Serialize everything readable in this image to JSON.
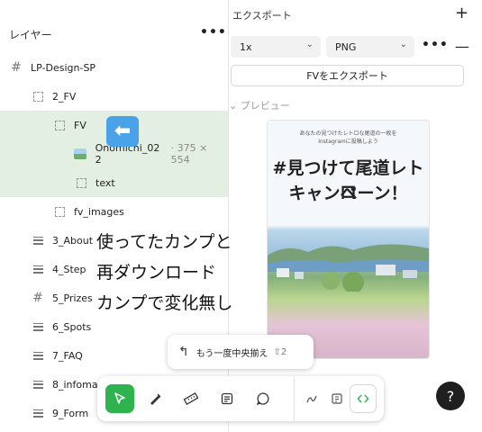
{
  "layers_panel": {
    "title": "レイヤー",
    "more": "•••",
    "rows": [
      {
        "label": "LP-Design-SP",
        "kind": "hash"
      },
      {
        "label": "2_FV",
        "kind": "frame"
      },
      {
        "label": "FV",
        "kind": "frame",
        "selected": true
      },
      {
        "label": "Onomichi_02 2",
        "dims": "· 375 × 554",
        "kind": "image",
        "selected": true
      },
      {
        "label": "text",
        "kind": "frame",
        "selected": true
      },
      {
        "label": "fv_images",
        "kind": "frame"
      },
      {
        "label": "3_About",
        "kind": "bars"
      },
      {
        "label": "4_Step",
        "kind": "bars"
      },
      {
        "label": "5_Prizes",
        "kind": "hash"
      },
      {
        "label": "6_Spots",
        "kind": "bars"
      },
      {
        "label": "7_FAQ",
        "kind": "bars"
      },
      {
        "label": "8_infomati",
        "kind": "bars"
      },
      {
        "label": "9_Form",
        "kind": "bars"
      }
    ]
  },
  "overlay": {
    "arrow": "⬅",
    "lines": [
      "使ってたカンプと",
      "再ダウンロード",
      "カンプで変化無し"
    ]
  },
  "export_panel": {
    "title": "エクスポート",
    "add": "+",
    "scale": "1x",
    "format": "PNG",
    "more": "•••",
    "remove": "—",
    "export_button": "FVをエクスポート",
    "preview_label": "⌄ プレビュー",
    "preview": {
      "sub_line1": "あなたの見つけたレトロな尾道の一枚を",
      "sub_line2": "Instagramに投稿しよう",
      "headline1": "#見つけて尾道レトロ",
      "headline2": "キャンペーン！"
    }
  },
  "undo_pill": {
    "label": "もう一度中央揃え",
    "shortcut": "⇧2"
  },
  "toolbar": {
    "tools": [
      "move-tool",
      "eyedropper-tool",
      "ruler-tool",
      "annotate-tool",
      "comment-tool",
      "draw-tool",
      "component-tool",
      "code-tool"
    ]
  },
  "help": "?",
  "colors": {
    "selected_row": "#e3efe3",
    "active_tool": "#2fb34f",
    "arrow_badge": "#4aa3e8"
  }
}
